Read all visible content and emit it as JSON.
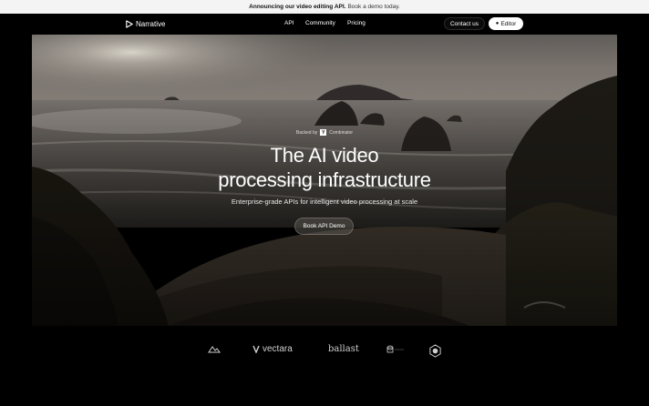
{
  "announcement": {
    "strong": "Announcing our video editing API.",
    "link": "Book a demo today."
  },
  "nav": {
    "brand": "Narrative",
    "links": [
      "API",
      "Community",
      "Pricing"
    ],
    "contact": "Contact us",
    "editor": "Editor"
  },
  "hero": {
    "backed_prefix": "Backed by",
    "yc_letter": "Y",
    "backed_suffix": "Combinator",
    "title_line1": "The AI video",
    "title_line2": "processing infrastructure",
    "subtitle": "Enterprise-grade APIs for intelligent video processing at scale",
    "cta": "Book API Demo"
  },
  "logos": {
    "vectara": "vectara",
    "ballast": "ballast"
  },
  "colors": {
    "announcement_bg": "#f4f4f4",
    "page_bg": "#000000",
    "editor_button_bg": "#ffffff"
  }
}
